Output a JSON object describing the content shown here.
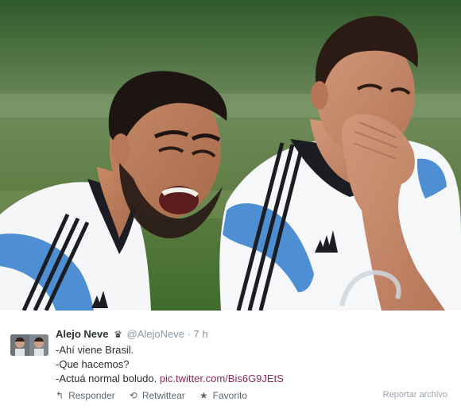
{
  "tweet": {
    "author_name": "Alejo Neve",
    "crown_icon": "crown-icon",
    "handle": "@AlejoNeve",
    "separator": "·",
    "time": "7 h",
    "lines": [
      "-Ahí viene Brasil.",
      "-Que hacemos?",
      "-Actuá normal boludo."
    ],
    "link_text": "pic.twitter.com/Bis6G9JEtS",
    "actions": {
      "reply": {
        "icon": "reply-icon",
        "label": "Responder"
      },
      "retweet": {
        "icon": "retweet-icon",
        "label": "Retwittear"
      },
      "favorite": {
        "icon": "star-icon",
        "label": "Favorito"
      }
    },
    "report_label": "Reportar archivo"
  },
  "colors": {
    "link": "#8a2c5b",
    "muted_text": "#8899a6",
    "primary_text": "#292f33"
  }
}
